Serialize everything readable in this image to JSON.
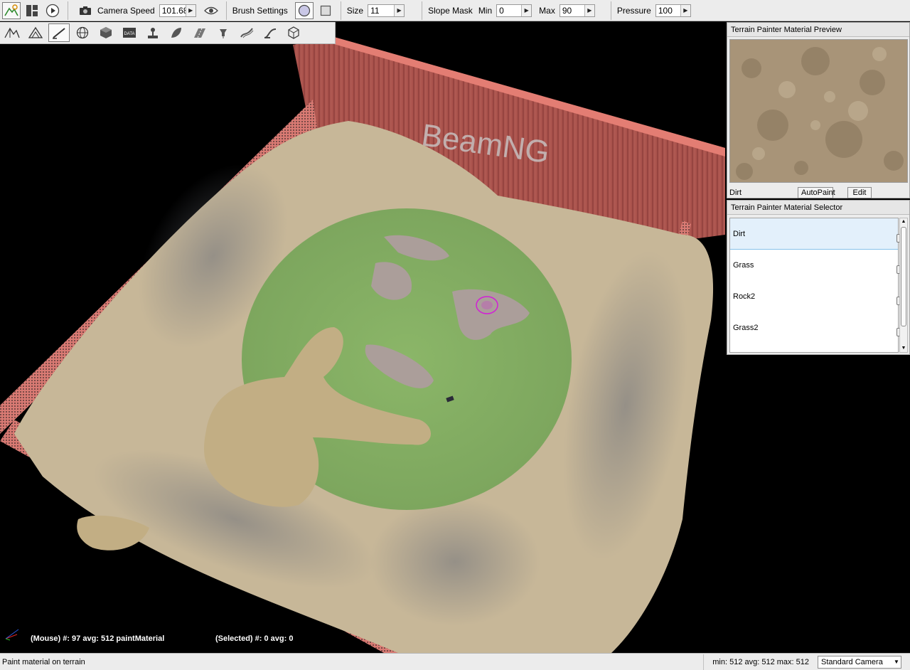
{
  "toolbar": {
    "camera_speed_label": "Camera Speed",
    "camera_speed_value": "101.68",
    "brush_settings_label": "Brush Settings",
    "size_label": "Size",
    "size_value": "11",
    "slope_mask_label": "Slope Mask",
    "min_label": "Min",
    "min_value": "0",
    "max_label": "Max",
    "max_value": "90",
    "pressure_label": "Pressure",
    "pressure_value": "100"
  },
  "viewport": {
    "watermark": "BeamNG",
    "mouse_info": "(Mouse) #: 97  avg: 512 paintMaterial",
    "selected_info": "(Selected) #: 0  avg: 0"
  },
  "preview_panel": {
    "title": "Terrain Painter Material Preview",
    "material_name": "Dirt",
    "autopaint_label": "AutoPaint",
    "edit_label": "Edit"
  },
  "selector_panel": {
    "title": "Terrain Painter Material Selector",
    "items": [
      {
        "label": "Dirt"
      },
      {
        "label": "Grass"
      },
      {
        "label": "Rock2"
      },
      {
        "label": "Grass2"
      }
    ]
  },
  "statusbar": {
    "message": "Paint material on terrain",
    "stats": "min: 512  avg: 512  max: 512",
    "camera_mode": "Standard Camera"
  },
  "colors": {
    "dirt": "#c9b99c",
    "grass": "#86ad63",
    "rock": "#aa9c98",
    "fence": "#e07c76",
    "container": "#a94f48",
    "brush": "#d21fd6"
  }
}
